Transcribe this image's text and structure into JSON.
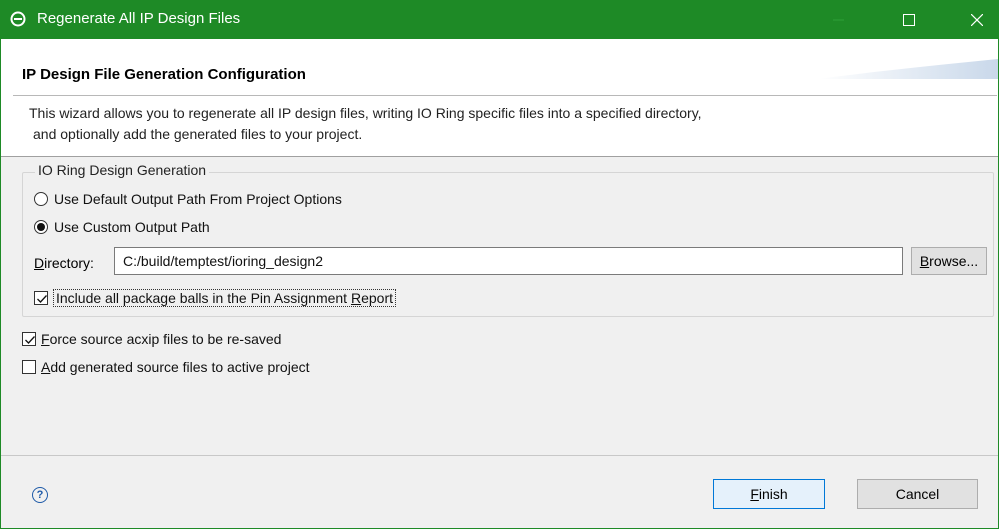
{
  "window": {
    "title": "Regenerate All IP Design Files",
    "accent_color": "#1e8a26",
    "icons": {
      "app": "eclipse-icon",
      "minimize": "minimize-icon",
      "maximize": "maximize-icon",
      "close": "close-icon"
    }
  },
  "header": {
    "title": "IP Design File Generation Configuration",
    "description_line1": "This wizard allows you to regenerate all IP design files, writing IO Ring specific files into a specified directory,",
    "description_line2": "and optionally add the generated files to your project."
  },
  "group": {
    "legend": "IO Ring Design Generation",
    "radio_default": {
      "label": "Use Default Output Path From Project Options",
      "checked": false
    },
    "radio_custom": {
      "label": "Use Custom Output Path",
      "checked": true
    },
    "directory": {
      "label_mnemonic": "D",
      "label_rest": "irectory:",
      "value": "C:/build/temptest/ioring_design2",
      "browse_mnemonic": "B",
      "browse_rest": "rowse..."
    },
    "include_balls": {
      "label_prefix": "Include all package balls in the Pin Assignment ",
      "label_mnemonic": "R",
      "label_suffix": "eport",
      "checked": true
    }
  },
  "options": {
    "force_resave": {
      "label_mnemonic": "F",
      "label_rest": "orce source acxip files to be re-saved",
      "checked": true
    },
    "add_to_project": {
      "label_mnemonic": "A",
      "label_rest": "dd generated source files to active project",
      "checked": false
    }
  },
  "footer": {
    "help_glyph": "?",
    "finish_mnemonic": "F",
    "finish_rest": "inish",
    "cancel_label": "Cancel"
  }
}
